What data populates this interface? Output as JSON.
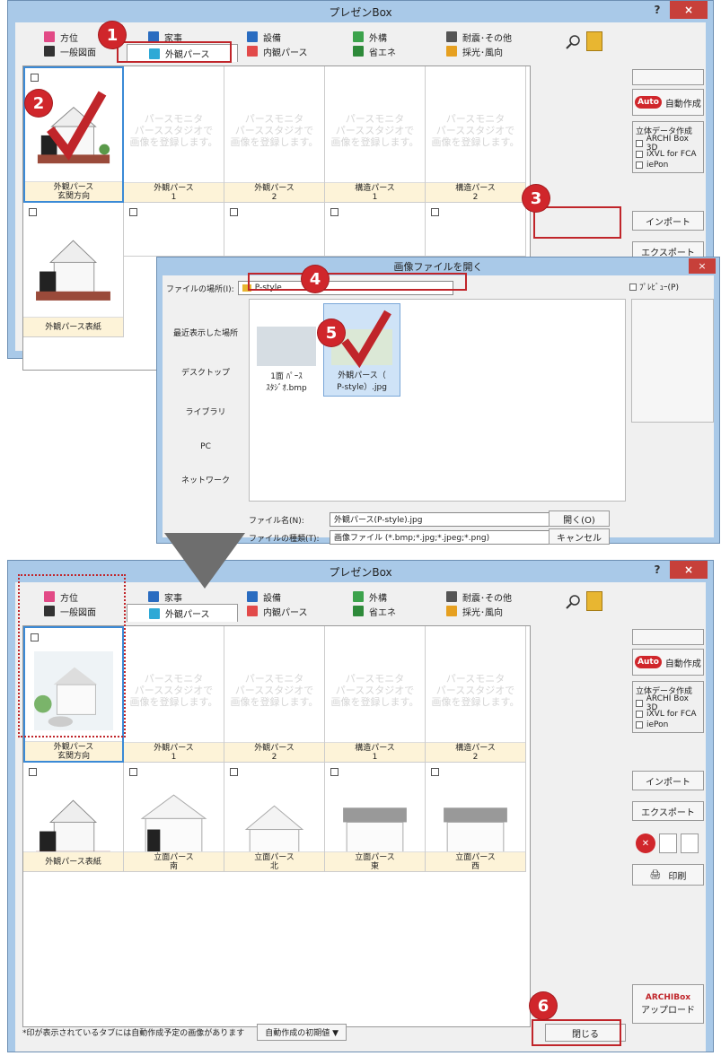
{
  "window_top": {
    "title": "プレゼンBox",
    "help": "?",
    "close": "×"
  },
  "tabs_row1": [
    "方位",
    "家事",
    "設備",
    "外構",
    "耐震･その他"
  ],
  "tabs_row2": [
    "一般図面",
    "外観パース",
    "内観パース",
    "省エネ",
    "採光･風向"
  ],
  "placeholder_text": [
    "パースモニタ",
    "パーススタジオで",
    "画像を登録します。"
  ],
  "top_grid": {
    "row1": [
      {
        "l1": "外観パース",
        "l2": "玄関方向"
      },
      {
        "l1": "外観パース",
        "l2": "1"
      },
      {
        "l1": "外観パース",
        "l2": "2"
      },
      {
        "l1": "構造パース",
        "l2": "1"
      },
      {
        "l1": "構造パース",
        "l2": "2"
      }
    ],
    "row2": [
      {
        "l1": "外観パース表紙",
        "l2": ""
      }
    ]
  },
  "right_panel": {
    "auto": "Auto",
    "auto_label": "自動作成",
    "data_title": "立体データ作成",
    "checks": [
      "ARCHI Box 3D",
      "iXVL for FCA",
      "iePon"
    ],
    "import": "インポート",
    "export": "エクスポート",
    "print": "印刷",
    "upload": "アップロード",
    "logo": "ARCHIBox",
    "close": "閉じる"
  },
  "dialog": {
    "title": "画像ファイルを開く",
    "location_label": "ファイルの場所(I):",
    "location": "P-style",
    "preview_label": "ﾌﾟﾚﾋﾞｭｰ(P)",
    "places": [
      "最近表示した場所",
      "デスクトップ",
      "ライブラリ",
      "PC",
      "ネットワーク"
    ],
    "files": [
      {
        "n1": "1面 ﾊﾟｰｽ",
        "n2": "ｽﾀｼﾞｵ.bmp"
      },
      {
        "n1": "外観パース（",
        "n2": "P-style）.jpg"
      }
    ],
    "filename_label": "ファイル名(N):",
    "filename": "外観パース(P-style).jpg",
    "filetype_label": "ファイルの種類(T):",
    "filetype": "画像ファイル (*.bmp;*.jpg;*.jpeg;*.png)",
    "open": "開く(O)",
    "cancel": "キャンセル"
  },
  "bottom_grid": {
    "row1": [
      {
        "l1": "外観パース",
        "l2": "玄関方向"
      },
      {
        "l1": "外観パース",
        "l2": "1"
      },
      {
        "l1": "外観パース",
        "l2": "2"
      },
      {
        "l1": "構造パース",
        "l2": "1"
      },
      {
        "l1": "構造パース",
        "l2": "2"
      }
    ],
    "row2": [
      {
        "l1": "外観パース表紙",
        "l2": ""
      },
      {
        "l1": "立面パース",
        "l2": "南"
      },
      {
        "l1": "立面パース",
        "l2": "北"
      },
      {
        "l1": "立面パース",
        "l2": "東"
      },
      {
        "l1": "立面パース",
        "l2": "西"
      }
    ]
  },
  "status": {
    "note": "*印が表示されているタブには自動作成予定の画像があります",
    "auto_default": "自動作成の初期値 ▼"
  },
  "step_badges": [
    "1",
    "2",
    "3",
    "4",
    "5",
    "6"
  ],
  "colors": {
    "accent": "#d0262b",
    "title_bg": "#a9c9e8",
    "caption_bg": "#fdf3d8",
    "select": "#3b8ad6"
  }
}
